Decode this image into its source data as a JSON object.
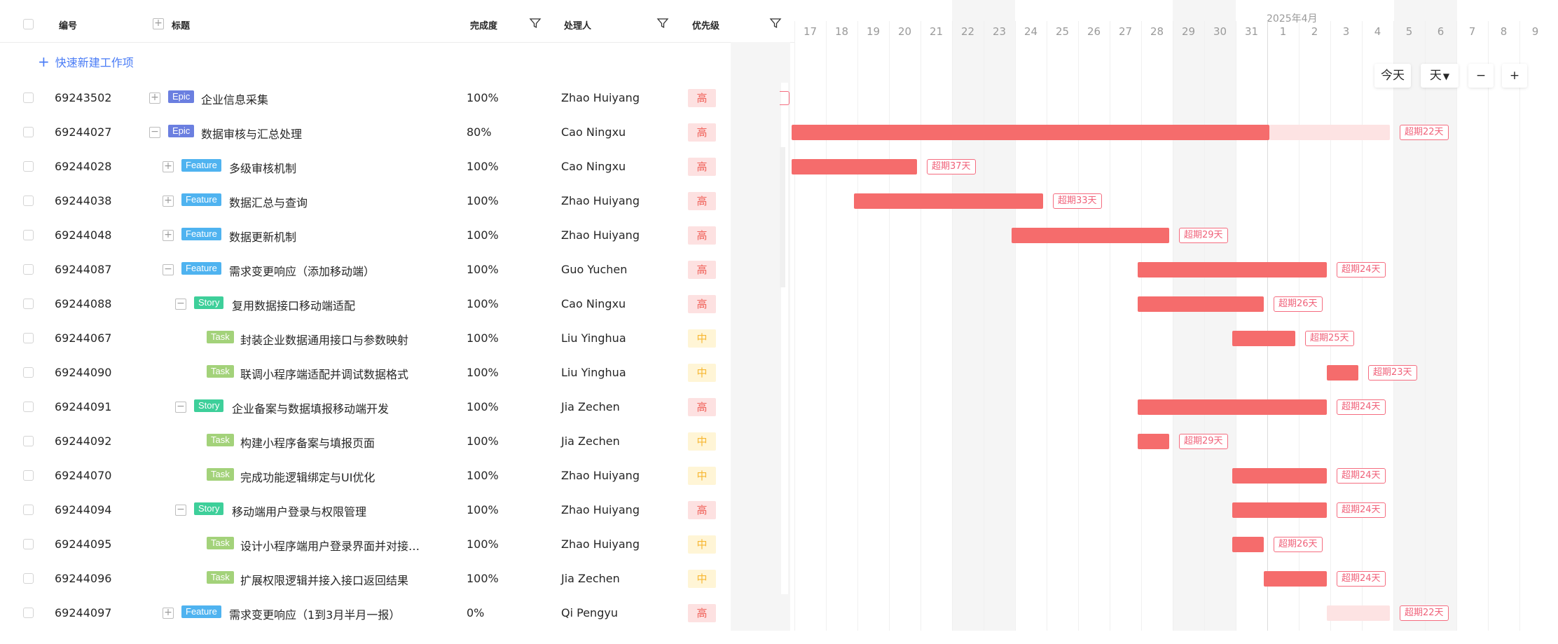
{
  "header": {
    "id_label": "编号",
    "title_label": "标题",
    "progress_label": "完成度",
    "assignee_label": "处理人",
    "priority_label": "优先级"
  },
  "quick_create": {
    "label": "快速新建工作项"
  },
  "timeline": {
    "month_label": "2025年4月",
    "days": [
      "17",
      "18",
      "19",
      "20",
      "21",
      "22",
      "23",
      "24",
      "25",
      "26",
      "27",
      "28",
      "29",
      "30",
      "31",
      "1",
      "2",
      "3",
      "4",
      "5",
      "6",
      "7",
      "8",
      "9"
    ]
  },
  "controls": {
    "today": "今天",
    "unit": "天",
    "zoom_out": "−",
    "zoom_in": "+"
  },
  "rows": [
    {
      "id": "69243502",
      "tag": "Epic",
      "title": "企业信息采集",
      "progress": "100%",
      "assignee": "Zhao Huiyang",
      "priority": "高",
      "overdue": ""
    },
    {
      "id": "69244027",
      "tag": "Epic",
      "title": "数据审核与汇总处理",
      "progress": "80%",
      "assignee": "Cao Ningxu",
      "priority": "高",
      "overdue": "超期22天"
    },
    {
      "id": "69244028",
      "tag": "Feature",
      "title": "多级审核机制",
      "progress": "100%",
      "assignee": "Cao Ningxu",
      "priority": "高",
      "overdue": "超期37天"
    },
    {
      "id": "69244038",
      "tag": "Feature",
      "title": "数据汇总与查询",
      "progress": "100%",
      "assignee": "Zhao Huiyang",
      "priority": "高",
      "overdue": "超期33天"
    },
    {
      "id": "69244048",
      "tag": "Feature",
      "title": "数据更新机制",
      "progress": "100%",
      "assignee": "Zhao Huiyang",
      "priority": "高",
      "overdue": "超期29天"
    },
    {
      "id": "69244087",
      "tag": "Feature",
      "title": "需求变更响应（添加移动端）",
      "progress": "100%",
      "assignee": "Guo Yuchen",
      "priority": "高",
      "overdue": "超期24天"
    },
    {
      "id": "69244088",
      "tag": "Story",
      "title": "复用数据接口移动端适配",
      "progress": "100%",
      "assignee": "Cao Ningxu",
      "priority": "高",
      "overdue": "超期26天"
    },
    {
      "id": "69244067",
      "tag": "Task",
      "title": "封装企业数据通用接口与参数映射",
      "progress": "100%",
      "assignee": "Liu Yinghua",
      "priority": "中",
      "overdue": "超期25天"
    },
    {
      "id": "69244090",
      "tag": "Task",
      "title": "联调小程序端适配并调试数据格式",
      "progress": "100%",
      "assignee": "Liu Yinghua",
      "priority": "中",
      "overdue": "超期23天"
    },
    {
      "id": "69244091",
      "tag": "Story",
      "title": "企业备案与数据填报移动端开发",
      "progress": "100%",
      "assignee": "Jia Zechen",
      "priority": "高",
      "overdue": "超期24天"
    },
    {
      "id": "69244092",
      "tag": "Task",
      "title": "构建小程序备案与填报页面",
      "progress": "100%",
      "assignee": "Jia Zechen",
      "priority": "中",
      "overdue": "超期29天"
    },
    {
      "id": "69244070",
      "tag": "Task",
      "title": "完成功能逻辑绑定与UI优化",
      "progress": "100%",
      "assignee": "Zhao Huiyang",
      "priority": "中",
      "overdue": "超期24天"
    },
    {
      "id": "69244094",
      "tag": "Story",
      "title": "移动端用户登录与权限管理",
      "progress": "100%",
      "assignee": "Zhao Huiyang",
      "priority": "高",
      "overdue": "超期24天"
    },
    {
      "id": "69244095",
      "tag": "Task",
      "title": "设计小程序端用户登录界面并对接…",
      "progress": "100%",
      "assignee": "Zhao Huiyang",
      "priority": "中",
      "overdue": "超期26天"
    },
    {
      "id": "69244096",
      "tag": "Task",
      "title": "扩展权限逻辑并接入接口返回结果",
      "progress": "100%",
      "assignee": "Jia Zechen",
      "priority": "中",
      "overdue": "超期24天"
    },
    {
      "id": "69244097",
      "tag": "Feature",
      "title": "需求变更响应（1到3月半月一报）",
      "progress": "0%",
      "assignee": "Qi Pengyu",
      "priority": "高",
      "overdue": "超期22天"
    }
  ],
  "colors": {
    "epic": "#6b7fe0",
    "feature": "#4fb3f0",
    "story": "#3ecf9a",
    "task": "#a3d27a",
    "bar": "#f56c6c",
    "link": "#4a7cf6"
  }
}
